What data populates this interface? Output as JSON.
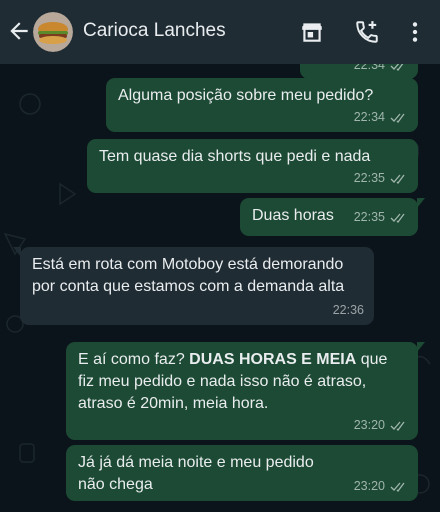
{
  "header": {
    "contact_name": "Carioca Lanches",
    "icons": [
      "back-arrow-icon",
      "store-icon",
      "add-call-icon",
      "more-vert-icon"
    ]
  },
  "colors": {
    "header_bg": "#1f2c34",
    "chat_bg": "#0b141a",
    "outgoing_bubble": "#1d4a34",
    "incoming_bubble": "#202c33",
    "text": "#e9edef"
  },
  "messages": [
    {
      "direction": "out",
      "text": "",
      "time": "22:34",
      "status": "read"
    },
    {
      "direction": "out",
      "text": "Alguma posição sobre meu pedido?",
      "time": "22:34",
      "status": "read"
    },
    {
      "direction": "out",
      "text": "Tem quase dia shorts que pedi e nada",
      "time": "22:35",
      "status": "read"
    },
    {
      "direction": "out",
      "text": "Duas horas",
      "time": "22:35",
      "status": "read"
    },
    {
      "direction": "in",
      "text": "Está em rota com Motoboy está demorando por conta que estamos com a demanda alta",
      "time": "22:36"
    },
    {
      "direction": "out",
      "text_before": "E aí como faz? ",
      "text_bold": "DUAS HORAS E MEIA",
      "text_after": " que fiz meu pedido e nada isso não é atraso, atraso é 20min, meia hora.",
      "time": "23:20",
      "status": "read"
    },
    {
      "direction": "out",
      "text": "Já já dá meia noite e meu pedido não chega",
      "time": "23:20",
      "status": "read"
    }
  ]
}
